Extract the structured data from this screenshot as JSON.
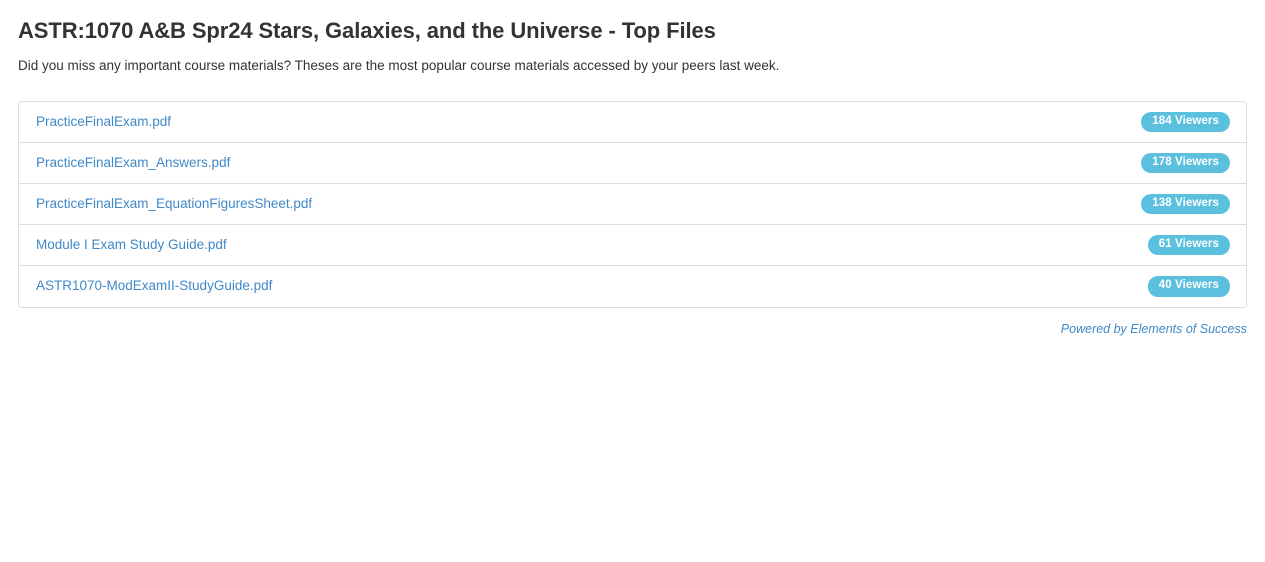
{
  "header": {
    "title": "ASTR:1070 A&B Spr24 Stars, Galaxies, and the Universe - Top Files",
    "subtitle": "Did you miss any important course materials? Theses are the most popular course materials accessed by your peers last week."
  },
  "files": [
    {
      "name": "PracticeFinalExam.pdf",
      "viewers": "184 Viewers"
    },
    {
      "name": "PracticeFinalExam_Answers.pdf",
      "viewers": "178 Viewers"
    },
    {
      "name": "PracticeFinalExam_EquationFiguresSheet.pdf",
      "viewers": "138 Viewers"
    },
    {
      "name": "Module I Exam Study Guide.pdf",
      "viewers": "61 Viewers"
    },
    {
      "name": "ASTR1070-ModExamII-StudyGuide.pdf",
      "viewers": "40 Viewers"
    }
  ],
  "footer": {
    "powered_by": "Powered by Elements of Success"
  },
  "colors": {
    "link": "#4089c8",
    "badge_background": "#5bc0de",
    "badge_text": "#ffffff",
    "title_text": "#333333",
    "panel_border": "#dddddd"
  }
}
